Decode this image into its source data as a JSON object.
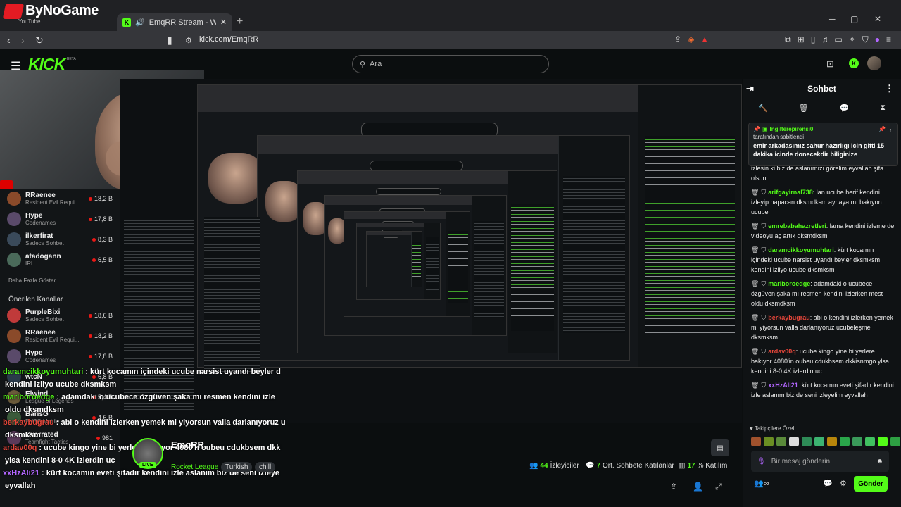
{
  "overlay_brand": {
    "name": "ByNoGame",
    "sub": "YouTube"
  },
  "browser": {
    "tab_title": "EmqRR Stream - Watch Live o",
    "url": "kick.com/EmqRR",
    "new_tab": "+",
    "min": "─",
    "max": "▢",
    "close": "✕"
  },
  "header": {
    "logo": "KICK",
    "beta": "BETA",
    "search_placeholder": "Ara"
  },
  "sidebar": {
    "channels_top": [
      {
        "name": "RRaenee",
        "category": "Resident Evil Requi...",
        "viewers": "18,2 B",
        "color": "#8a4a2a"
      },
      {
        "name": "Hype",
        "category": "Codenames",
        "viewers": "17,8 B",
        "color": "#5a4a6a"
      },
      {
        "name": "ilkerfirat",
        "category": "Sadece Sohbet",
        "viewers": "8,3 B",
        "color": "#3a4a5a"
      },
      {
        "name": "atadogann",
        "category": "IRL",
        "viewers": "6,5 B",
        "color": "#4a6a5a"
      }
    ],
    "show_more": "Daha Fazla Göster",
    "recommended_title": "Önerilen Kanallar",
    "channels_rec": [
      {
        "name": "PurpleBixi",
        "category": "Sadece Sohbet",
        "viewers": "18,6 B",
        "color": "#c03a3a"
      },
      {
        "name": "RRaenee",
        "category": "Resident Evil Requi...",
        "viewers": "18,2 B",
        "color": "#8a4a2a"
      },
      {
        "name": "Hype",
        "category": "Codenames",
        "viewers": "17,8 B",
        "color": "#5a4a6a"
      },
      {
        "name": "wtcN",
        "category": "",
        "viewers": "6,8 B",
        "color": "#2a3a4a"
      },
      {
        "name": "Elwind",
        "category": "League of Legends",
        "viewers": "5,4 B",
        "color": "#6a5a3a"
      },
      {
        "name": "BarisG",
        "category": "PUBG Mobile",
        "viewers": "4,6 B",
        "color": "#3a5a3a"
      },
      {
        "name": "Cverrated",
        "category": "Teamfight Tactics",
        "viewers": "981",
        "color": "#5a3a5a"
      }
    ]
  },
  "overlay_chat": [
    {
      "user": "daramcikkoyumuhtari",
      "color": "#53fc18",
      "text": ": kürt kocamın içindeki ucube narsist uyandı beyler d"
    },
    {
      "user": "",
      "color": "#fff",
      "text": "kendini izliyo ucube dksmksm"
    },
    {
      "user": "marlboroedge",
      "color": "#53fc18",
      "text": ": adamdaki o ucubece özgüven şaka mı resmen kendini izle"
    },
    {
      "user": "",
      "color": "#fff",
      "text": "oldu dksmdksm"
    },
    {
      "user": "berkaybugrau",
      "color": "#e5463a",
      "text": ": abi o kendini izlerken yemek mi yiyorsun valla darlanıyoruz u"
    },
    {
      "user": "",
      "color": "#fff",
      "text": "dksmksm"
    },
    {
      "user": "ardav00q",
      "color": "#e5463a",
      "text": ": ucube kingo yine bi yerlere bakıyor 4080'n oubeu cdukbsem dkk"
    },
    {
      "user": "",
      "color": "#fff",
      "text": "ylsa kendini 8-0 4K izlerdin uc"
    },
    {
      "user": "xxHzAli21",
      "color": "#b266ff",
      "text": ": kürt kocamın eveti şifadır kendini izle aslanım biz de seni izleye"
    },
    {
      "user": "",
      "color": "#fff",
      "text": "eyvallah"
    }
  ],
  "stream_info": {
    "name": "EmqRR",
    "live": "LIVE",
    "category": "Rocket League",
    "tags": [
      "Turkish",
      "chill"
    ],
    "viewers": "44",
    "viewers_label": "İzleyiciler",
    "chatters": "7",
    "chatters_label": "Ort. Sohbete Katılanlar",
    "rate": "17",
    "rate_label": "% Katılım"
  },
  "chat": {
    "title": "Sohbet",
    "pinned": {
      "user": "Ingilterepirensi0",
      "by": "tarafından sabitlendi",
      "text": "emir arkadasımız sahur hazırlıgı icin gitti 15 dakika icinde donecekdir biliginize"
    },
    "messages": [
      {
        "user": "",
        "color": "#fff",
        "text": "izlesin ki biz de aslanımızı görelim eyvallah şifa olsun"
      },
      {
        "user": "arifgayirnal738",
        "color": "#53fc18",
        "text": ": lan ucube herif kendini izleyip napacan dksmdksm aynaya mı bakıyon ucube"
      },
      {
        "user": "emrebabahazretleri",
        "color": "#53fc18",
        "text": ": lama kendini izleme de videoyu aç artık dksmdksm"
      },
      {
        "user": "daramcikkoyumuhtari",
        "color": "#53fc18",
        "text": ": kürt kocamın içindeki ucube narsist uyandı beyler dksmksm kendini izliyo ucube dksmksm"
      },
      {
        "user": "marlboroedge",
        "color": "#53fc18",
        "text": ": adamdaki o ucubece özgüven şaka mı resmen kendini izlerken mest oldu dksmdksm"
      },
      {
        "user": "berkaybugrau",
        "color": "#e5463a",
        "text": ": abi o kendini izlerken yemek mi yiyorsun valla darlanıyoruz ucubeleşme dksmksm"
      },
      {
        "user": "ardav00q",
        "color": "#e5463a",
        "text": ": ucube kingo yine bi yerlere bakıyor 4080'in oubeu cdukbsem dkkisnmgo ylsa kendini 8-0 4K izlerdin uc"
      },
      {
        "user": "xxHzAli21",
        "color": "#b266ff",
        "text": ": kürt kocamın eveti şifadır kendini izle aslanım biz de seni izleyelim eyvallah"
      }
    ],
    "supporters": "Takipçilere Özel",
    "input_placeholder": "Bir mesaj gönderin",
    "send": "Gönder"
  }
}
